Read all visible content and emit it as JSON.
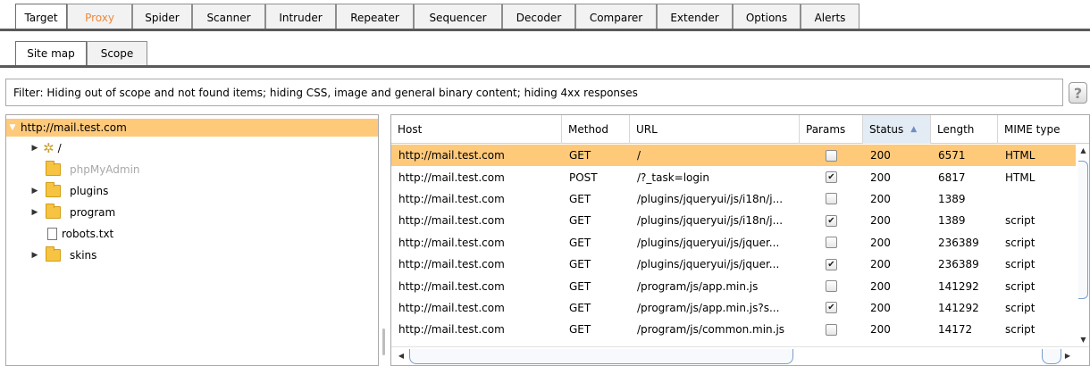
{
  "main_tabs": [
    "Target",
    "Proxy",
    "Spider",
    "Scanner",
    "Intruder",
    "Repeater",
    "Sequencer",
    "Decoder",
    "Comparer",
    "Extender",
    "Options",
    "Alerts"
  ],
  "sub_tabs": [
    "Site map",
    "Scope"
  ],
  "filter": {
    "text": "Filter:  Hiding out of scope and not found items;  hiding CSS, image and general binary content;  hiding 4xx responses",
    "help_label": "?"
  },
  "tree": {
    "root": "http://mail.test.com",
    "items": [
      {
        "label": "/",
        "icon": "gear-icon",
        "expandable": true
      },
      {
        "label": "phpMyAdmin",
        "icon": "folder-icon",
        "expandable": false
      },
      {
        "label": "plugins",
        "icon": "folder-icon",
        "expandable": true
      },
      {
        "label": "program",
        "icon": "folder-icon",
        "expandable": true
      },
      {
        "label": "robots.txt",
        "icon": "file-icon",
        "expandable": false
      },
      {
        "label": "skins",
        "icon": "folder-icon",
        "expandable": true
      }
    ]
  },
  "table": {
    "columns": [
      "Host",
      "Method",
      "URL",
      "Params",
      "Status",
      "Length",
      "MIME type"
    ],
    "sort_column": "Status",
    "sort_indicator": "▲",
    "rows": [
      {
        "host": "http://mail.test.com",
        "method": "GET",
        "url": "/",
        "params": false,
        "status": "200",
        "length": "6571",
        "mime": "HTML"
      },
      {
        "host": "http://mail.test.com",
        "method": "POST",
        "url": "/?_task=login",
        "params": true,
        "status": "200",
        "length": "6817",
        "mime": "HTML"
      },
      {
        "host": "http://mail.test.com",
        "method": "GET",
        "url": "/plugins/jqueryui/js/i18n/j...",
        "params": false,
        "status": "200",
        "length": "1389",
        "mime": ""
      },
      {
        "host": "http://mail.test.com",
        "method": "GET",
        "url": "/plugins/jqueryui/js/i18n/j...",
        "params": true,
        "status": "200",
        "length": "1389",
        "mime": "script"
      },
      {
        "host": "http://mail.test.com",
        "method": "GET",
        "url": "/plugins/jqueryui/js/jquer...",
        "params": false,
        "status": "200",
        "length": "236389",
        "mime": "script"
      },
      {
        "host": "http://mail.test.com",
        "method": "GET",
        "url": "/plugins/jqueryui/js/jquer...",
        "params": true,
        "status": "200",
        "length": "236389",
        "mime": "script"
      },
      {
        "host": "http://mail.test.com",
        "method": "GET",
        "url": "/program/js/app.min.js",
        "params": false,
        "status": "200",
        "length": "141292",
        "mime": "script"
      },
      {
        "host": "http://mail.test.com",
        "method": "GET",
        "url": "/program/js/app.min.js?s...",
        "params": true,
        "status": "200",
        "length": "141292",
        "mime": "script"
      },
      {
        "host": "http://mail.test.com",
        "method": "GET",
        "url": "/program/js/common.min.js",
        "params": false,
        "status": "200",
        "length": "14172",
        "mime": "script"
      }
    ]
  },
  "colors": {
    "selection": "#ffc97a",
    "proxy_tab_text": "#f0883a",
    "sorted_header": "#e3ebf4"
  }
}
